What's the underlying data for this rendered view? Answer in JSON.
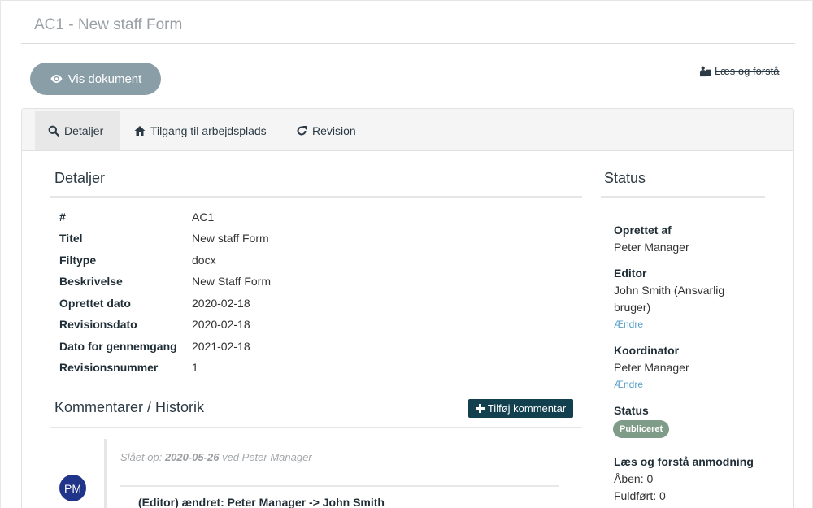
{
  "page": {
    "title": "AC1 - New staff Form"
  },
  "actions": {
    "view_document": "Vis dokument",
    "read_understand": "Læs og forstå"
  },
  "tabs": [
    {
      "label": "Detaljer",
      "icon": "search-icon"
    },
    {
      "label": "Tilgang til arbejdsplads",
      "icon": "home-icon"
    },
    {
      "label": "Revision",
      "icon": "refresh-icon"
    }
  ],
  "details": {
    "heading": "Detaljer",
    "rows": [
      {
        "key": "#",
        "value": "AC1"
      },
      {
        "key": "Titel",
        "value": "New staff Form"
      },
      {
        "key": "Filtype",
        "value": "docx"
      },
      {
        "key": "Beskrivelse",
        "value": "New Staff Form"
      },
      {
        "key": "Oprettet dato",
        "value": "2020-02-18"
      },
      {
        "key": "Revisionsdato",
        "value": "2020-02-18"
      },
      {
        "key": "Dato for gennemgang",
        "value": "2021-02-18"
      },
      {
        "key": "Revisionsnummer",
        "value": "1"
      }
    ]
  },
  "comments": {
    "heading": "Kommentarer / Historik",
    "add_button": "Tilføj kommentar",
    "entry": {
      "meta_prefix": "Slået op:",
      "meta_date": "2020-05-26",
      "meta_suffix": "ved Peter Manager",
      "avatar": "PM",
      "text": "(Editor) ændret: Peter Manager -> John Smith"
    }
  },
  "status": {
    "heading": "Status",
    "created_by_label": "Oprettet af",
    "created_by": "Peter Manager",
    "editor_label": "Editor",
    "editor": "John Smith (Ansvarlig bruger)",
    "editor_change": "Ændre",
    "coordinator_label": "Koordinator",
    "coordinator": "Peter Manager",
    "coordinator_change": "Ændre",
    "status_label": "Status",
    "status_badge": "Publiceret",
    "read_request_label": "Læs og forstå anmodning",
    "open": "Åben: 0",
    "completed": "Fuldført: 0"
  },
  "colors": {
    "primary_dark": "#12404e",
    "button_grey": "#8a9ea8",
    "badge_green": "#7f9c88",
    "avatar_blue": "#20348a",
    "link_blue": "#5aa0c8"
  }
}
